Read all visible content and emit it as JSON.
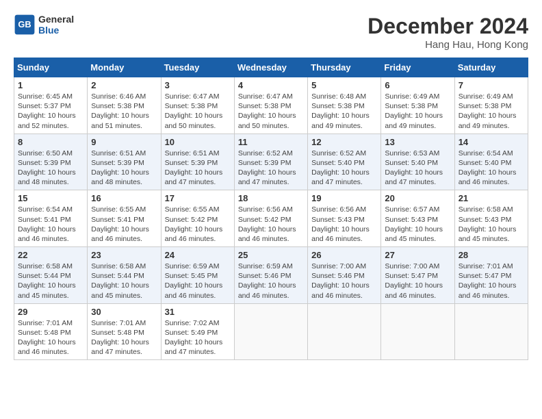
{
  "header": {
    "logo_line1": "General",
    "logo_line2": "Blue",
    "month": "December 2024",
    "location": "Hang Hau, Hong Kong"
  },
  "weekdays": [
    "Sunday",
    "Monday",
    "Tuesday",
    "Wednesday",
    "Thursday",
    "Friday",
    "Saturday"
  ],
  "weeks": [
    [
      {
        "day": "1",
        "sunrise": "6:45 AM",
        "sunset": "5:37 PM",
        "daylight": "10 hours and 52 minutes."
      },
      {
        "day": "2",
        "sunrise": "6:46 AM",
        "sunset": "5:38 PM",
        "daylight": "10 hours and 51 minutes."
      },
      {
        "day": "3",
        "sunrise": "6:47 AM",
        "sunset": "5:38 PM",
        "daylight": "10 hours and 50 minutes."
      },
      {
        "day": "4",
        "sunrise": "6:47 AM",
        "sunset": "5:38 PM",
        "daylight": "10 hours and 50 minutes."
      },
      {
        "day": "5",
        "sunrise": "6:48 AM",
        "sunset": "5:38 PM",
        "daylight": "10 hours and 49 minutes."
      },
      {
        "day": "6",
        "sunrise": "6:49 AM",
        "sunset": "5:38 PM",
        "daylight": "10 hours and 49 minutes."
      },
      {
        "day": "7",
        "sunrise": "6:49 AM",
        "sunset": "5:38 PM",
        "daylight": "10 hours and 49 minutes."
      }
    ],
    [
      {
        "day": "8",
        "sunrise": "6:50 AM",
        "sunset": "5:39 PM",
        "daylight": "10 hours and 48 minutes."
      },
      {
        "day": "9",
        "sunrise": "6:51 AM",
        "sunset": "5:39 PM",
        "daylight": "10 hours and 48 minutes."
      },
      {
        "day": "10",
        "sunrise": "6:51 AM",
        "sunset": "5:39 PM",
        "daylight": "10 hours and 47 minutes."
      },
      {
        "day": "11",
        "sunrise": "6:52 AM",
        "sunset": "5:39 PM",
        "daylight": "10 hours and 47 minutes."
      },
      {
        "day": "12",
        "sunrise": "6:52 AM",
        "sunset": "5:40 PM",
        "daylight": "10 hours and 47 minutes."
      },
      {
        "day": "13",
        "sunrise": "6:53 AM",
        "sunset": "5:40 PM",
        "daylight": "10 hours and 47 minutes."
      },
      {
        "day": "14",
        "sunrise": "6:54 AM",
        "sunset": "5:40 PM",
        "daylight": "10 hours and 46 minutes."
      }
    ],
    [
      {
        "day": "15",
        "sunrise": "6:54 AM",
        "sunset": "5:41 PM",
        "daylight": "10 hours and 46 minutes."
      },
      {
        "day": "16",
        "sunrise": "6:55 AM",
        "sunset": "5:41 PM",
        "daylight": "10 hours and 46 minutes."
      },
      {
        "day": "17",
        "sunrise": "6:55 AM",
        "sunset": "5:42 PM",
        "daylight": "10 hours and 46 minutes."
      },
      {
        "day": "18",
        "sunrise": "6:56 AM",
        "sunset": "5:42 PM",
        "daylight": "10 hours and 46 minutes."
      },
      {
        "day": "19",
        "sunrise": "6:56 AM",
        "sunset": "5:43 PM",
        "daylight": "10 hours and 46 minutes."
      },
      {
        "day": "20",
        "sunrise": "6:57 AM",
        "sunset": "5:43 PM",
        "daylight": "10 hours and 45 minutes."
      },
      {
        "day": "21",
        "sunrise": "6:58 AM",
        "sunset": "5:43 PM",
        "daylight": "10 hours and 45 minutes."
      }
    ],
    [
      {
        "day": "22",
        "sunrise": "6:58 AM",
        "sunset": "5:44 PM",
        "daylight": "10 hours and 45 minutes."
      },
      {
        "day": "23",
        "sunrise": "6:58 AM",
        "sunset": "5:44 PM",
        "daylight": "10 hours and 45 minutes."
      },
      {
        "day": "24",
        "sunrise": "6:59 AM",
        "sunset": "5:45 PM",
        "daylight": "10 hours and 46 minutes."
      },
      {
        "day": "25",
        "sunrise": "6:59 AM",
        "sunset": "5:46 PM",
        "daylight": "10 hours and 46 minutes."
      },
      {
        "day": "26",
        "sunrise": "7:00 AM",
        "sunset": "5:46 PM",
        "daylight": "10 hours and 46 minutes."
      },
      {
        "day": "27",
        "sunrise": "7:00 AM",
        "sunset": "5:47 PM",
        "daylight": "10 hours and 46 minutes."
      },
      {
        "day": "28",
        "sunrise": "7:01 AM",
        "sunset": "5:47 PM",
        "daylight": "10 hours and 46 minutes."
      }
    ],
    [
      {
        "day": "29",
        "sunrise": "7:01 AM",
        "sunset": "5:48 PM",
        "daylight": "10 hours and 46 minutes."
      },
      {
        "day": "30",
        "sunrise": "7:01 AM",
        "sunset": "5:48 PM",
        "daylight": "10 hours and 47 minutes."
      },
      {
        "day": "31",
        "sunrise": "7:02 AM",
        "sunset": "5:49 PM",
        "daylight": "10 hours and 47 minutes."
      },
      null,
      null,
      null,
      null
    ]
  ]
}
